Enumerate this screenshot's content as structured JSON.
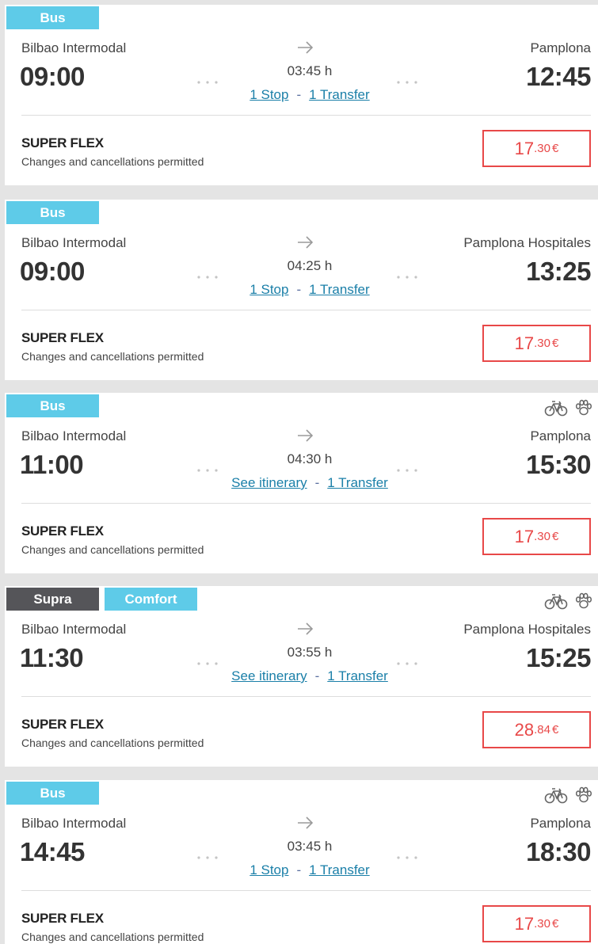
{
  "journeys": [
    {
      "badges": [
        {
          "label": "Bus",
          "style": "bus"
        }
      ],
      "amenities": [],
      "origin": "Bilbao Intermodal",
      "destination": "Pamplona",
      "departure": "09:00",
      "arrival": "12:45",
      "duration": "03:45 h",
      "stops_link": "1 Stop",
      "transfer_link": "1 Transfer",
      "separator": "-",
      "fare_name": "SUPER FLEX",
      "fare_desc": "Changes and cancellations permitted",
      "price_int": "17",
      "price_dec": ".30",
      "currency": "€"
    },
    {
      "badges": [
        {
          "label": "Bus",
          "style": "bus"
        }
      ],
      "amenities": [],
      "origin": "Bilbao Intermodal",
      "destination": "Pamplona Hospitales",
      "departure": "09:00",
      "arrival": "13:25",
      "duration": "04:25 h",
      "stops_link": "1 Stop",
      "transfer_link": "1 Transfer",
      "separator": "-",
      "fare_name": "SUPER FLEX",
      "fare_desc": "Changes and cancellations permitted",
      "price_int": "17",
      "price_dec": ".30",
      "currency": "€"
    },
    {
      "badges": [
        {
          "label": "Bus",
          "style": "bus"
        }
      ],
      "amenities": [
        "bike-icon",
        "pet-paw-icon"
      ],
      "origin": "Bilbao Intermodal",
      "destination": "Pamplona",
      "departure": "11:00",
      "arrival": "15:30",
      "duration": "04:30 h",
      "stops_link": "See itinerary",
      "transfer_link": "1 Transfer",
      "separator": "-",
      "fare_name": "SUPER FLEX",
      "fare_desc": "Changes and cancellations permitted",
      "price_int": "17",
      "price_dec": ".30",
      "currency": "€"
    },
    {
      "badges": [
        {
          "label": "Supra",
          "style": "supra"
        },
        {
          "label": "Comfort",
          "style": "comfort"
        }
      ],
      "amenities": [
        "bike-icon",
        "pet-paw-icon"
      ],
      "origin": "Bilbao Intermodal",
      "destination": "Pamplona Hospitales",
      "departure": "11:30",
      "arrival": "15:25",
      "duration": "03:55 h",
      "stops_link": "See itinerary",
      "transfer_link": "1 Transfer",
      "separator": "-",
      "fare_name": "SUPER FLEX",
      "fare_desc": "Changes and cancellations permitted",
      "price_int": "28",
      "price_dec": ".84",
      "currency": "€"
    },
    {
      "badges": [
        {
          "label": "Bus",
          "style": "bus"
        }
      ],
      "amenities": [
        "bike-icon",
        "pet-paw-icon"
      ],
      "origin": "Bilbao Intermodal",
      "destination": "Pamplona",
      "departure": "14:45",
      "arrival": "18:30",
      "duration": "03:45 h",
      "stops_link": "1 Stop",
      "transfer_link": "1 Transfer",
      "separator": "-",
      "fare_name": "SUPER FLEX",
      "fare_desc": "Changes and cancellations permitted",
      "price_int": "17",
      "price_dec": ".30",
      "currency": "€"
    }
  ]
}
